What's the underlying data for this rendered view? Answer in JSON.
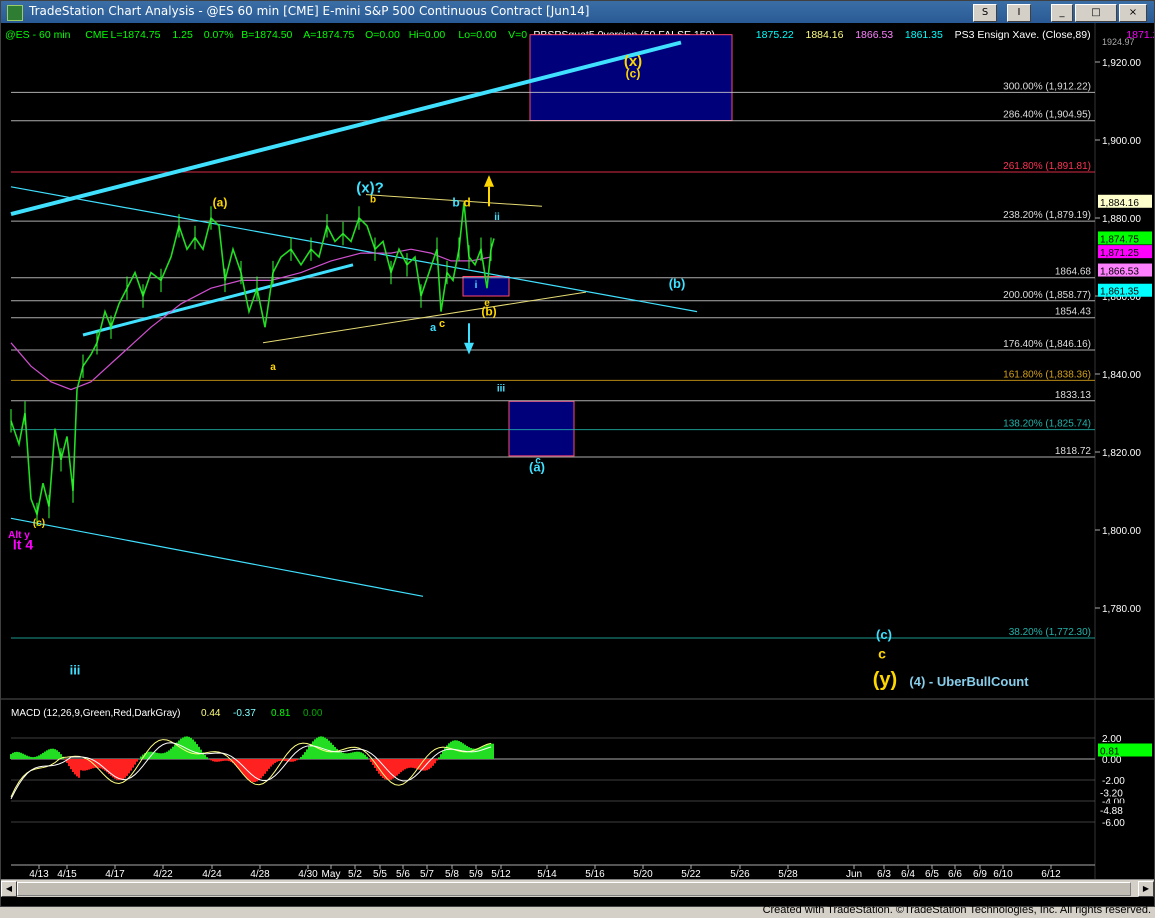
{
  "window": {
    "title": "TradeStation Chart Analysis - @ES 60 min [CME] E-mini S&P 500 Continuous Contract [Jun14]",
    "buttons": [
      "S",
      "I",
      "_",
      "□",
      "×"
    ]
  },
  "header": {
    "symbol": "@ES - 60 min",
    "exchange": "CME",
    "last": "L=1874.75",
    "change": "1.25",
    "change_pct": "0.07%",
    "bid": "B=1874.50",
    "ask": "A=1874.75",
    "open": "O=0.00",
    "high": "Hi=0.00",
    "low": "Lo=0.00",
    "volume": "V=0",
    "indicator": "PBSPSquat5.0version (50,FALSE,150)",
    "ind_values": [
      "1875.22",
      "1884.16",
      "1866.53",
      "1861.35"
    ],
    "ps3": "PS3 Ensign Xave. (Close,89)",
    "ps3_value": "1871.25",
    "colors": {
      "symbol": "#00ff00",
      "ind1": "#00ffff",
      "ind2": "#ffff80",
      "ind3": "#ff80ff",
      "ind4": "#00ffff",
      "ps3": "#ff00ff"
    }
  },
  "price_axis": {
    "ticks": [
      "1,920.00",
      "1,900.00",
      "1,880.00",
      "1,860.00",
      "1,840.00",
      "1,820.00",
      "1,800.00",
      "1,780.00"
    ],
    "top_partial": "1924.97"
  },
  "price_tags": [
    {
      "label": "1,884.16",
      "bg": "#ffffcc",
      "fg": "#000000",
      "price": 1884.16
    },
    {
      "label": "1,874.75",
      "bg": "#00ff00",
      "fg": "#000000",
      "price": 1874.75
    },
    {
      "label": "1,871.25",
      "bg": "#ff00ff",
      "fg": "#000000",
      "price": 1871.25
    },
    {
      "label": "1,866.53",
      "bg": "#ff80ff",
      "fg": "#000000",
      "price": 1866.53
    },
    {
      "label": "1,861.35",
      "bg": "#00ffff",
      "fg": "#000000",
      "price": 1861.35
    }
  ],
  "fib_levels": [
    {
      "label": "300.00% (1,912.22)",
      "price": 1912.22,
      "color": "#cccccc"
    },
    {
      "label": "286.40% (1,904.95)",
      "price": 1904.95,
      "color": "#cccccc"
    },
    {
      "label": "261.80% (1,891.81)",
      "price": 1891.81,
      "color": "#ff3355"
    },
    {
      "label": "238.20% (1,879.19)",
      "price": 1879.19,
      "color": "#cccccc"
    },
    {
      "label": "1864.68",
      "price": 1864.68,
      "color": "#cccccc"
    },
    {
      "label": "200.00% (1,858.77)",
      "price": 1858.77,
      "color": "#cccccc"
    },
    {
      "label": "1854.43",
      "price": 1854.43,
      "color": "#cccccc"
    },
    {
      "label": "176.40% (1,846.16)",
      "price": 1846.16,
      "color": "#cccccc"
    },
    {
      "label": "161.80% (1,838.36)",
      "price": 1838.36,
      "color": "#d4a017"
    },
    {
      "label": "1833.13",
      "price": 1833.13,
      "color": "#cccccc"
    },
    {
      "label": "138.20% (1,825.74)",
      "price": 1825.74,
      "color": "#20b2aa"
    },
    {
      "label": "1818.72",
      "price": 1818.72,
      "color": "#cccccc"
    },
    {
      "label": "38.20% (1,772.30)",
      "price": 1772.3,
      "color": "#20b2aa"
    }
  ],
  "wave_labels": [
    {
      "text": "(x)",
      "color": "#ffd700",
      "pos": "top-box",
      "size": 15
    },
    {
      "text": "(c)",
      "color": "#ffd700",
      "pos": "top-box2",
      "size": 12
    },
    {
      "text": "(a)",
      "color": "#ffd700",
      "pos": "a-top",
      "size": 12
    },
    {
      "text": "(x)?",
      "color": "#40e0ff",
      "pos": "x-peak",
      "size": 15
    },
    {
      "text": "b",
      "color": "#ffd700",
      "pos": "b-small",
      "size": 10
    },
    {
      "text": "b",
      "color": "#40e0ff",
      "pos": "b2",
      "size": 12
    },
    {
      "text": "d",
      "color": "#ffd700",
      "pos": "d",
      "size": 12
    },
    {
      "text": "ii",
      "color": "#40e0ff",
      "pos": "ii",
      "size": 10
    },
    {
      "text": "(b)",
      "color": "#40e0ff",
      "pos": "b-right",
      "size": 13
    },
    {
      "text": "i",
      "color": "#40e0ff",
      "pos": "i",
      "size": 10
    },
    {
      "text": "e",
      "color": "#ffd700",
      "pos": "e",
      "size": 10
    },
    {
      "text": "(b)",
      "color": "#ffd700",
      "pos": "b-yel",
      "size": 12
    },
    {
      "text": "a",
      "color": "#40e0ff",
      "pos": "a-cyan",
      "size": 11
    },
    {
      "text": "c",
      "color": "#ffd700",
      "pos": "c-yel",
      "size": 11
    },
    {
      "text": "a",
      "color": "#ffd700",
      "pos": "a-low",
      "size": 10
    },
    {
      "text": "iii",
      "color": "#40e0ff",
      "pos": "iii-mid",
      "size": 10
    },
    {
      "text": "c",
      "color": "#40e0ff",
      "pos": "c-box",
      "size": 10
    },
    {
      "text": "(a)",
      "color": "#40e0ff",
      "pos": "a-box",
      "size": 13
    },
    {
      "text": "(c)",
      "color": "#ffd700",
      "pos": "c-left",
      "size": 10
    },
    {
      "text": "Alt y",
      "color": "#ff00ff",
      "pos": "alty",
      "size": 10
    },
    {
      "text": "lt 4",
      "color": "#ff00ff",
      "pos": "alt4",
      "size": 14
    },
    {
      "text": "iii",
      "color": "#40e0ff",
      "pos": "iii-left",
      "size": 13
    },
    {
      "text": "(c)",
      "color": "#40e0ff",
      "pos": "c-right",
      "size": 13
    },
    {
      "text": "c",
      "color": "#ffd700",
      "pos": "c-right2",
      "size": 14
    },
    {
      "text": "(y)",
      "color": "#ffd700",
      "pos": "y-right",
      "size": 20
    },
    {
      "text": "(4) - UberBullCount",
      "color": "#87ceeb",
      "pos": "uber",
      "size": 13
    }
  ],
  "macd": {
    "label": "MACD (12,26,9,Green,Red,DarkGray)",
    "values": [
      "0.44",
      "-0.37",
      "0.81",
      "0.00"
    ],
    "value_colors": [
      "#ffff80",
      "#80ffff",
      "#00ff00",
      "#00aa00"
    ],
    "axis_ticks": [
      "2.00",
      "0.00",
      "-2.00",
      "-4.00",
      "-6.00"
    ],
    "axis_values": [
      2,
      0,
      -2,
      -4,
      -6
    ],
    "tags": [
      {
        "label": "0.81",
        "bg": "#00ff00",
        "value": 0.81
      },
      {
        "label": "-3.20",
        "bg": "#000000",
        "value": -3.2
      },
      {
        "label": "-4.88",
        "bg": "#000000",
        "value": -4.88
      }
    ]
  },
  "x_axis": {
    "labels": [
      "4/13",
      "4/15",
      "4/17",
      "4/22",
      "4/24",
      "4/28",
      "4/30",
      "May",
      "5/2",
      "5/5",
      "5/6",
      "5/7",
      "5/8",
      "5/9",
      "5/12",
      "5/14",
      "5/16",
      "5/20",
      "5/22",
      "5/26",
      "5/28",
      "Jun",
      "6/3",
      "6/4",
      "6/5",
      "6/6",
      "6/9",
      "6/10",
      "6/12"
    ]
  },
  "footer": "Created with TradeStation. ©TradeStation Technologies, Inc. All rights reserved.",
  "chart_data": {
    "type": "line",
    "title": "@ES 60 min [CME] E-mini S&P 500 Continuous Contract [Jun14]",
    "ylim": [
      1762,
      1927
    ],
    "series": [
      {
        "name": "@ES - 60 min",
        "x": [
          "4/13",
          "4/15",
          "4/17",
          "4/22",
          "4/24",
          "4/28",
          "4/30",
          "May",
          "5/2",
          "5/5",
          "5/6",
          "5/7",
          "5/8",
          "5/9"
        ],
        "values": [
          1808,
          1828,
          1858,
          1872,
          1878,
          1852,
          1876,
          1880,
          1884,
          1872,
          1868,
          1858,
          1884,
          1874.75
        ]
      }
    ],
    "fib_levels": [
      1912.22,
      1904.95,
      1891.81,
      1879.19,
      1864.68,
      1858.77,
      1854.43,
      1846.16,
      1838.36,
      1833.13,
      1825.74,
      1818.72,
      1772.3
    ]
  }
}
